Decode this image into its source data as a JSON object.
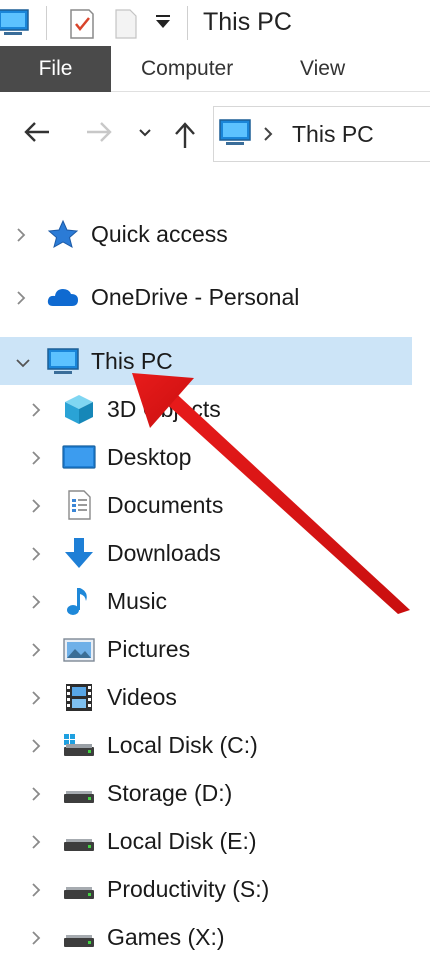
{
  "window": {
    "title": "This PC"
  },
  "ribbon": {
    "tabs": [
      "File",
      "Computer",
      "View"
    ]
  },
  "address_bar": {
    "path_text": "This PC"
  },
  "navigation_pane": {
    "top_items": [
      {
        "label": "Quick access",
        "icon": "star-icon",
        "expanded": false
      },
      {
        "label": "OneDrive - Personal",
        "icon": "onedrive-cloud-icon",
        "expanded": false
      },
      {
        "label": "This PC",
        "icon": "computer-icon",
        "expanded": true,
        "selected": true
      }
    ],
    "this_pc_children": [
      {
        "label": "3D Objects",
        "icon": "3d-objects-icon"
      },
      {
        "label": "Desktop",
        "icon": "desktop-icon"
      },
      {
        "label": "Documents",
        "icon": "documents-icon"
      },
      {
        "label": "Downloads",
        "icon": "downloads-icon"
      },
      {
        "label": "Music",
        "icon": "music-icon"
      },
      {
        "label": "Pictures",
        "icon": "pictures-icon"
      },
      {
        "label": "Videos",
        "icon": "videos-icon"
      },
      {
        "label": "Local Disk (C:)",
        "icon": "system-drive-icon"
      },
      {
        "label": "Storage (D:)",
        "icon": "drive-icon"
      },
      {
        "label": "Local Disk (E:)",
        "icon": "drive-icon"
      },
      {
        "label": "Productivity (S:)",
        "icon": "drive-icon"
      },
      {
        "label": "Games (X:)",
        "icon": "drive-icon"
      }
    ]
  },
  "colors": {
    "selection": "#cce4f7",
    "file_tab": "#4a4a4a",
    "annotation_arrow": "#e02020",
    "accent_blue": "#1e88e5"
  }
}
